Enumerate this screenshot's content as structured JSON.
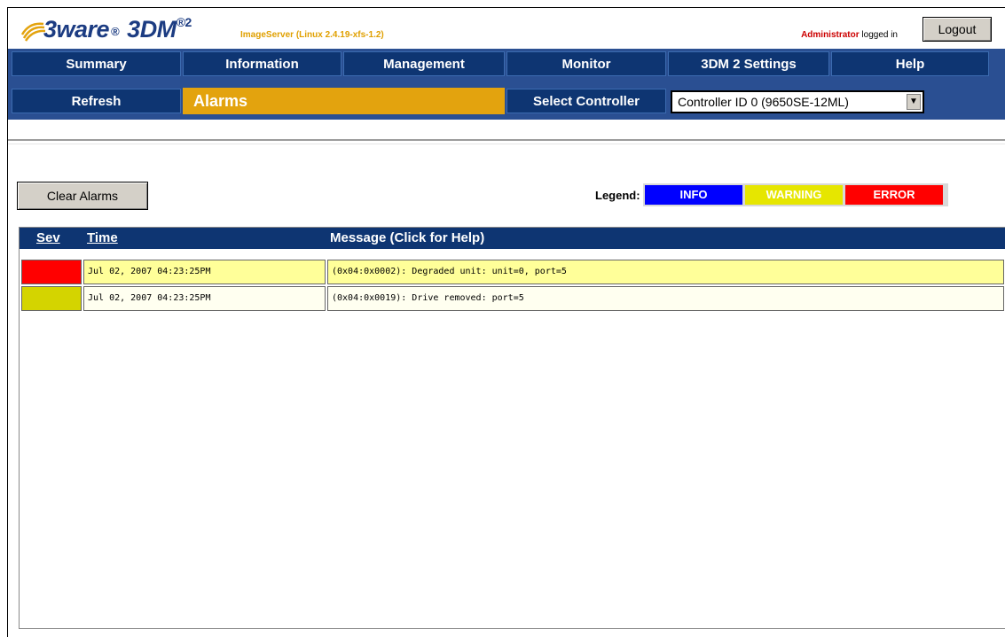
{
  "header": {
    "logo_3ware": "3ware",
    "logo_reg": "®",
    "logo_3dm": "3DM",
    "logo_sup": "®2",
    "server_info": "ImageServer (Linux 2.4.19-xfs-1.2)",
    "admin_name": "Administrator",
    "logged_in_text": "logged in",
    "logout_label": "Logout",
    "brand_color": "#1c3c82",
    "accent_color": "#e3a30e"
  },
  "nav": {
    "row1": [
      "Summary",
      "Information",
      "Management",
      "Monitor",
      "3DM 2 Settings",
      "Help"
    ],
    "refresh_label": "Refresh",
    "active_page": "Alarms",
    "select_controller_label": "Select Controller",
    "controller_selected": "Controller ID 0 (9650SE-12ML)",
    "dropdown_icon": "chevron-down-icon"
  },
  "toolbar": {
    "clear_alarms_label": "Clear Alarms"
  },
  "legend": {
    "label": "Legend:",
    "items": [
      {
        "label": "INFO",
        "color": "#0000ff"
      },
      {
        "label": "WARNING",
        "color": "#e6e600"
      },
      {
        "label": "ERROR",
        "color": "#ff0000"
      }
    ]
  },
  "alarms_table": {
    "headers": {
      "sev": "Sev",
      "time": "Time",
      "message": "Message (Click for Help)"
    },
    "rows": [
      {
        "severity": "ERROR",
        "sev_color": "#ff0000",
        "time": "Jul 02, 2007 04:23:25PM",
        "message": "(0x04:0x0002): Degraded unit: unit=0, port=5",
        "row_color": "#ffff99"
      },
      {
        "severity": "WARNING",
        "sev_color": "#d4d400",
        "time": "Jul 02, 2007 04:23:25PM",
        "message": "(0x04:0x0019): Drive removed: port=5",
        "row_color": "#fffff0"
      }
    ]
  }
}
